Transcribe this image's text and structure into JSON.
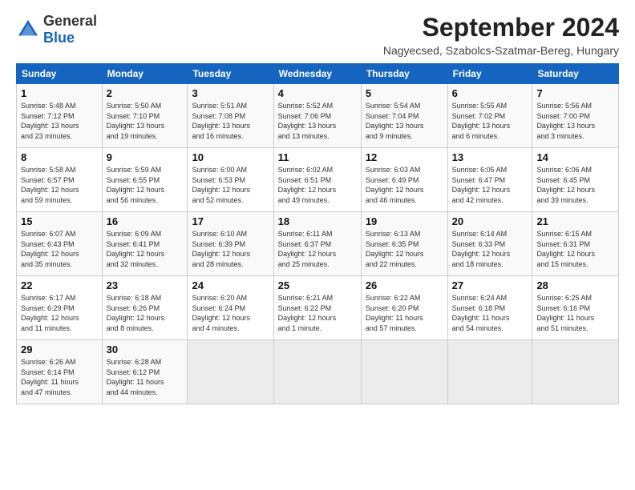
{
  "header": {
    "logo_general": "General",
    "logo_blue": "Blue",
    "title": "September 2024",
    "subtitle": "Nagyecsed, Szabolcs-Szatmar-Bereg, Hungary"
  },
  "weekdays": [
    "Sunday",
    "Monday",
    "Tuesday",
    "Wednesday",
    "Thursday",
    "Friday",
    "Saturday"
  ],
  "weeks": [
    [
      {
        "day": "1",
        "detail": "Sunrise: 5:48 AM\nSunset: 7:12 PM\nDaylight: 13 hours\nand 23 minutes."
      },
      {
        "day": "2",
        "detail": "Sunrise: 5:50 AM\nSunset: 7:10 PM\nDaylight: 13 hours\nand 19 minutes."
      },
      {
        "day": "3",
        "detail": "Sunrise: 5:51 AM\nSunset: 7:08 PM\nDaylight: 13 hours\nand 16 minutes."
      },
      {
        "day": "4",
        "detail": "Sunrise: 5:52 AM\nSunset: 7:06 PM\nDaylight: 13 hours\nand 13 minutes."
      },
      {
        "day": "5",
        "detail": "Sunrise: 5:54 AM\nSunset: 7:04 PM\nDaylight: 13 hours\nand 9 minutes."
      },
      {
        "day": "6",
        "detail": "Sunrise: 5:55 AM\nSunset: 7:02 PM\nDaylight: 13 hours\nand 6 minutes."
      },
      {
        "day": "7",
        "detail": "Sunrise: 5:56 AM\nSunset: 7:00 PM\nDaylight: 13 hours\nand 3 minutes."
      }
    ],
    [
      {
        "day": "8",
        "detail": "Sunrise: 5:58 AM\nSunset: 6:57 PM\nDaylight: 12 hours\nand 59 minutes."
      },
      {
        "day": "9",
        "detail": "Sunrise: 5:59 AM\nSunset: 6:55 PM\nDaylight: 12 hours\nand 56 minutes."
      },
      {
        "day": "10",
        "detail": "Sunrise: 6:00 AM\nSunset: 6:53 PM\nDaylight: 12 hours\nand 52 minutes."
      },
      {
        "day": "11",
        "detail": "Sunrise: 6:02 AM\nSunset: 6:51 PM\nDaylight: 12 hours\nand 49 minutes."
      },
      {
        "day": "12",
        "detail": "Sunrise: 6:03 AM\nSunset: 6:49 PM\nDaylight: 12 hours\nand 46 minutes."
      },
      {
        "day": "13",
        "detail": "Sunrise: 6:05 AM\nSunset: 6:47 PM\nDaylight: 12 hours\nand 42 minutes."
      },
      {
        "day": "14",
        "detail": "Sunrise: 6:06 AM\nSunset: 6:45 PM\nDaylight: 12 hours\nand 39 minutes."
      }
    ],
    [
      {
        "day": "15",
        "detail": "Sunrise: 6:07 AM\nSunset: 6:43 PM\nDaylight: 12 hours\nand 35 minutes."
      },
      {
        "day": "16",
        "detail": "Sunrise: 6:09 AM\nSunset: 6:41 PM\nDaylight: 12 hours\nand 32 minutes."
      },
      {
        "day": "17",
        "detail": "Sunrise: 6:10 AM\nSunset: 6:39 PM\nDaylight: 12 hours\nand 28 minutes."
      },
      {
        "day": "18",
        "detail": "Sunrise: 6:11 AM\nSunset: 6:37 PM\nDaylight: 12 hours\nand 25 minutes."
      },
      {
        "day": "19",
        "detail": "Sunrise: 6:13 AM\nSunset: 6:35 PM\nDaylight: 12 hours\nand 22 minutes."
      },
      {
        "day": "20",
        "detail": "Sunrise: 6:14 AM\nSunset: 6:33 PM\nDaylight: 12 hours\nand 18 minutes."
      },
      {
        "day": "21",
        "detail": "Sunrise: 6:15 AM\nSunset: 6:31 PM\nDaylight: 12 hours\nand 15 minutes."
      }
    ],
    [
      {
        "day": "22",
        "detail": "Sunrise: 6:17 AM\nSunset: 6:29 PM\nDaylight: 12 hours\nand 11 minutes."
      },
      {
        "day": "23",
        "detail": "Sunrise: 6:18 AM\nSunset: 6:26 PM\nDaylight: 12 hours\nand 8 minutes."
      },
      {
        "day": "24",
        "detail": "Sunrise: 6:20 AM\nSunset: 6:24 PM\nDaylight: 12 hours\nand 4 minutes."
      },
      {
        "day": "25",
        "detail": "Sunrise: 6:21 AM\nSunset: 6:22 PM\nDaylight: 12 hours\nand 1 minute."
      },
      {
        "day": "26",
        "detail": "Sunrise: 6:22 AM\nSunset: 6:20 PM\nDaylight: 11 hours\nand 57 minutes."
      },
      {
        "day": "27",
        "detail": "Sunrise: 6:24 AM\nSunset: 6:18 PM\nDaylight: 11 hours\nand 54 minutes."
      },
      {
        "day": "28",
        "detail": "Sunrise: 6:25 AM\nSunset: 6:16 PM\nDaylight: 11 hours\nand 51 minutes."
      }
    ],
    [
      {
        "day": "29",
        "detail": "Sunrise: 6:26 AM\nSunset: 6:14 PM\nDaylight: 11 hours\nand 47 minutes."
      },
      {
        "day": "30",
        "detail": "Sunrise: 6:28 AM\nSunset: 6:12 PM\nDaylight: 11 hours\nand 44 minutes."
      },
      {
        "day": "",
        "detail": ""
      },
      {
        "day": "",
        "detail": ""
      },
      {
        "day": "",
        "detail": ""
      },
      {
        "day": "",
        "detail": ""
      },
      {
        "day": "",
        "detail": ""
      }
    ]
  ]
}
